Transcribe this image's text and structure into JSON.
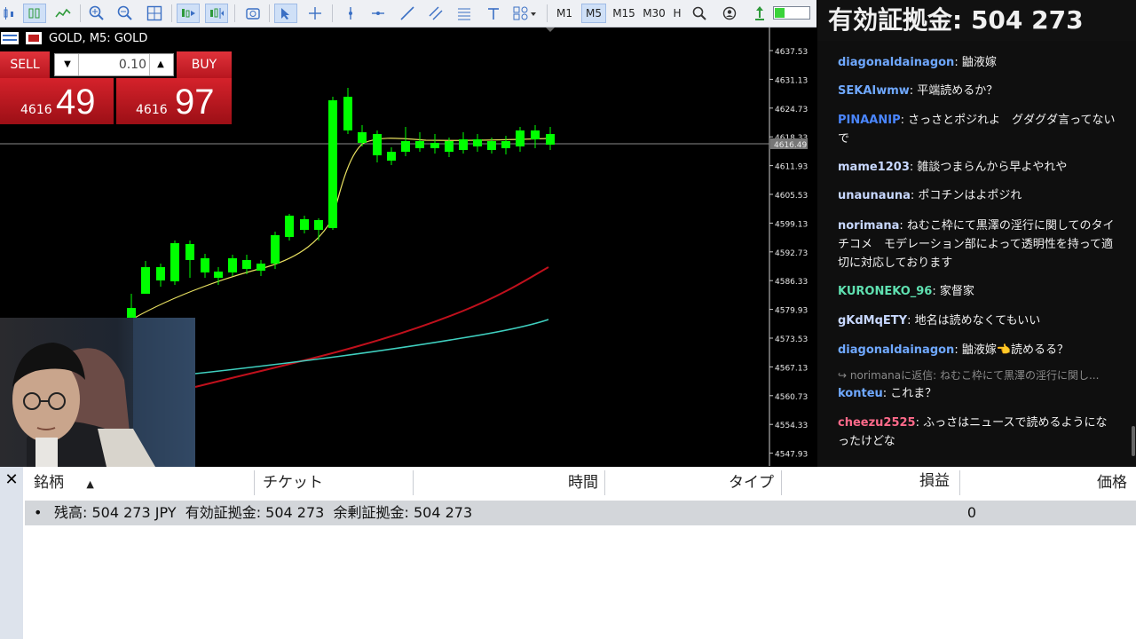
{
  "toolbar": {
    "icons": [
      "candles-icon",
      "bars-icon",
      "line-chart-icon",
      "zoom-in-icon",
      "zoom-out-icon",
      "grid-icon",
      "autoscroll-icon",
      "chart-shift-icon",
      "screenshot-icon",
      "cursor-icon",
      "crosshair-icon",
      "vertical-line-icon",
      "horizontal-line-icon",
      "trendline-icon",
      "channel-icon",
      "fibonacci-icon",
      "text-icon",
      "shapes-icon",
      "search-icon",
      "account-icon",
      "signal-icon"
    ],
    "timeframes": [
      "M1",
      "M5",
      "M15",
      "M30",
      "H"
    ],
    "selected_timeframe": "M5"
  },
  "chart": {
    "title": "GOLD, M5:  GOLD",
    "price_labels": [
      "4637.53",
      "4631.13",
      "4624.73",
      "4618.33",
      "4611.93",
      "4605.53",
      "4599.13",
      "4592.73",
      "4586.33",
      "4579.93",
      "4573.53",
      "4567.13",
      "4560.73",
      "4554.33",
      "4547.93"
    ],
    "current_price_label": "4616.49",
    "colors": {
      "bull": "#00ff00",
      "ma_fast": "#e8e060",
      "ma_mid": "#c0101c",
      "ma_slow": "#3fd0c0"
    }
  },
  "trade_panel": {
    "sell_label": "SELL",
    "buy_label": "BUY",
    "volume": "0.10",
    "sell_price_prefix": "4616",
    "sell_price_big": "49",
    "buy_price_prefix": "4616",
    "buy_price_big": "97"
  },
  "chat": {
    "header": "有効証拠金: 504 273",
    "messages": [
      {
        "user": "diagonaldainagon",
        "text": "鼬液嫁",
        "color": "#6fa8ff"
      },
      {
        "user": "SEKAIwmw",
        "text": "平端読めるか？",
        "color": "#6fa8ff"
      },
      {
        "user": "PINAANIP",
        "text": "さっさとポジれよ　グダグダ言ってないで",
        "color": "#4a86ff"
      },
      {
        "user": "mame1203",
        "text": "雑談つまらんから早よやれや",
        "color": "#c8d8ff"
      },
      {
        "user": "unaunauna",
        "text": "ポコチンはよポジれ",
        "color": "#c8d8ff"
      },
      {
        "user": "norimana",
        "text": "ねむこ枠にて黒澤の淫行に関してのタイチコメ　モデレーション部によって透明性を持って適切に対応しております",
        "color": "#c8d8ff"
      },
      {
        "user": "KURONEKO_96",
        "text": "家督家",
        "color": "#5fe0b0"
      },
      {
        "user": "gKdMqETY",
        "text": "地名は読めなくてもいい",
        "color": "#c8d8ff"
      },
      {
        "user": "diagonaldainagon",
        "text": "鼬液嫁👈読めるる？",
        "color": "#6fa8ff"
      },
      {
        "user": "konteu",
        "text": "これま？",
        "color": "#6fa8ff"
      },
      {
        "user": "cheezu2525",
        "text": "ふっさはニュースで読めるようになったけどな",
        "color": "#ff6a8a"
      }
    ],
    "reply_indicator": "norimanaに返信: ねむこ枠にて黒澤の淫行に関し..."
  },
  "terminal": {
    "columns": [
      "銘柄",
      "チケット",
      "時間",
      "タイプ",
      "損益",
      "価格"
    ],
    "account_summary": "残高: 504 273 JPY  有効証拠金: 504 273  余剰証拠金: 504 273",
    "profit": "0"
  }
}
